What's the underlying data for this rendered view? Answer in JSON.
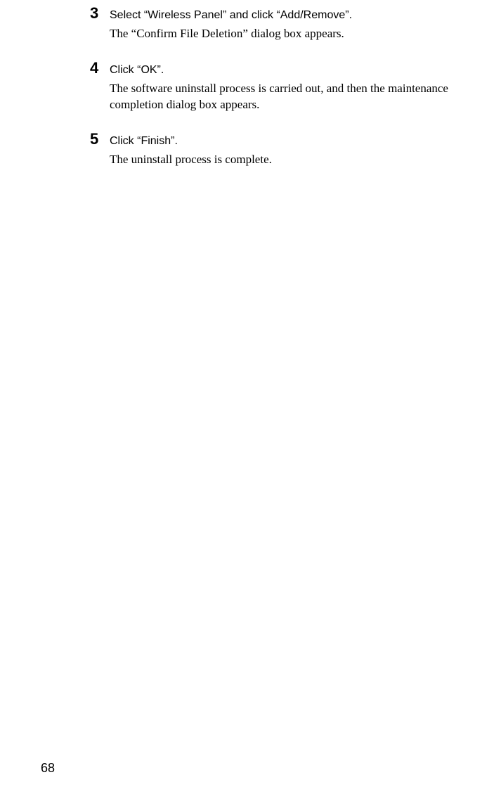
{
  "steps": [
    {
      "number": "3",
      "title": "Select “Wireless Panel” and click “Add/Remove”.",
      "body": "The “Confirm File Deletion” dialog box appears."
    },
    {
      "number": "4",
      "title": "Click “OK”.",
      "body": "The software uninstall process is carried out, and then the maintenance completion dialog box appears."
    },
    {
      "number": "5",
      "title": "Click “Finish”.",
      "body": "The uninstall process is complete."
    }
  ],
  "page_number": "68"
}
